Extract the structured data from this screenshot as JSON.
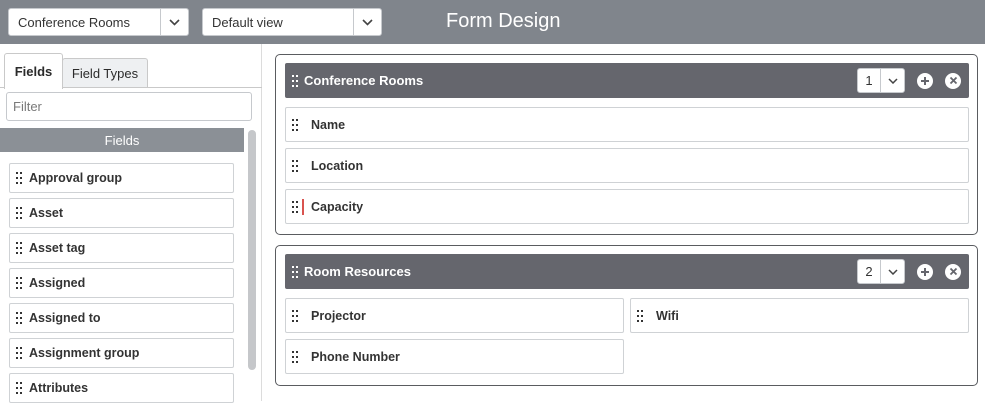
{
  "toolbar": {
    "table_select": "Conference Rooms",
    "view_select": "Default view",
    "title": "Form Design"
  },
  "left_panel": {
    "tabs": [
      {
        "label": "Fields",
        "active": true
      },
      {
        "label": "Field Types",
        "active": false
      }
    ],
    "filter_placeholder": "Filter",
    "list_header": "Fields",
    "fields": [
      "Approval group",
      "Asset",
      "Asset tag",
      "Assigned",
      "Assigned to",
      "Assignment group",
      "Attributes"
    ]
  },
  "sections": [
    {
      "title": "Conference Rooms",
      "columns": "1",
      "rows": [
        "Name",
        "Location",
        "Capacity"
      ]
    },
    {
      "title": "Room Resources",
      "columns": "2",
      "rows": [
        "Projector",
        "Wifi",
        "Phone Number"
      ]
    }
  ],
  "colors": {
    "topbar": "#80858c",
    "section_header": "#65666d",
    "fields_header": "#8b9096",
    "cursor_marker": "#d9534f"
  }
}
